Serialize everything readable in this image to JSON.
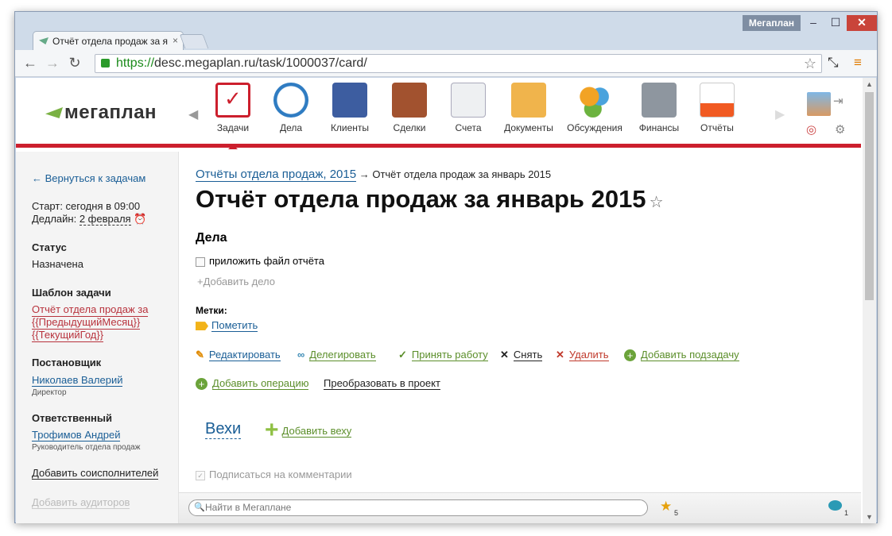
{
  "browser": {
    "app_name": "Мегаплан",
    "tab_title": "Отчёт отдела продаж за я",
    "url_scheme": "https://",
    "url_rest": "desc.megaplan.ru/task/1000037/card/"
  },
  "header": {
    "logo": "мегаплан",
    "modules": [
      {
        "label": "Задачи",
        "icon": "tasks-icon"
      },
      {
        "label": "Дела",
        "icon": "clock-icon"
      },
      {
        "label": "Клиенты",
        "icon": "clients-icon"
      },
      {
        "label": "Сделки",
        "icon": "briefcase-icon"
      },
      {
        "label": "Счета",
        "icon": "invoice-icon"
      },
      {
        "label": "Документы",
        "icon": "folder-icon"
      },
      {
        "label": "Обсуждения",
        "icon": "chat-icon"
      },
      {
        "label": "Финансы",
        "icon": "safe-icon"
      },
      {
        "label": "Отчёты",
        "icon": "report-icon"
      }
    ],
    "active_module": "Задачи"
  },
  "sidebar": {
    "back_link": "Вернуться к задачам",
    "start": "Старт: сегодня в 09:00",
    "deadline_label": "Дедлайн:",
    "deadline_value": "2 февраля",
    "status_heading": "Статус",
    "status_value": "Назначена",
    "template_heading": "Шаблон задачи",
    "template_line1": "Отчёт отдела продаж за",
    "template_line2": "{{ПредыдущийМесяц}}",
    "template_line3": "{{ТекущийГод}}",
    "author_heading": "Постановщик",
    "author_name": "Николаев Валерий",
    "author_role": "Директор",
    "responsible_heading": "Ответственный",
    "responsible_name": "Трофимов Андрей",
    "responsible_role": "Руководитель отдела продаж",
    "add_coexecutors": "Добавить соисполнителей",
    "add_auditors": "Добавить аудиторов"
  },
  "task": {
    "breadcrumb_parent": "Отчёты отдела продаж, 2015",
    "breadcrumb_arrow": "→",
    "breadcrumb_current": "Отчёт отдела продаж за январь 2015",
    "title": "Отчёт отдела продаж за январь 2015",
    "todos_heading": "Дела",
    "todo_item": "приложить файл отчёта",
    "add_todo": "Добавить дело",
    "labels_heading": "Метки:",
    "mark_label": "Пометить",
    "actions": {
      "edit": "Редактировать",
      "delegate": "Делегировать",
      "accept": "Принять работу",
      "remove": "Снять",
      "delete": "Удалить",
      "add_subtask": "Добавить подзадачу",
      "add_operation": "Добавить операцию",
      "convert": "Преобразовать в проект"
    },
    "milestones_heading": "Вехи",
    "add_milestone": "Добавить веху",
    "subscribe": "Подписаться на комментарии"
  },
  "bottombar": {
    "search_placeholder": "Найти в Мегаплане",
    "favorites_count": "5",
    "comments_count": "1"
  },
  "colors": {
    "accent_red": "#cc1f2d",
    "link_blue": "#1a5e96",
    "action_green": "#5b8e2a"
  }
}
